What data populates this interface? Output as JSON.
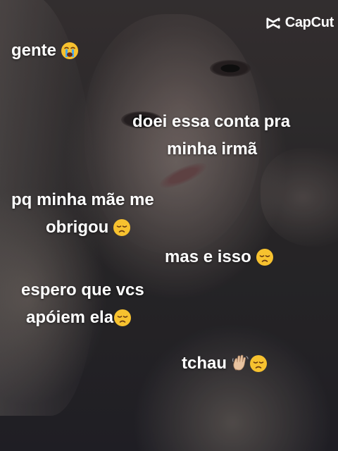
{
  "watermark": {
    "label": "CapCut",
    "icon": "capcut-logo-icon"
  },
  "captions": [
    {
      "text": "gente",
      "emoji": "loudly-crying-face-icon"
    },
    {
      "text": "doei essa conta pra"
    },
    {
      "text": "minha irmã"
    },
    {
      "text": "pq minha mãe me"
    },
    {
      "text": "obrigou",
      "emoji": "disappointed-face-icon"
    },
    {
      "text": "mas e isso",
      "emoji": "disappointed-face-icon"
    },
    {
      "text": "espero que vcs"
    },
    {
      "text": "apóiem ela",
      "emoji": "disappointed-face-icon"
    },
    {
      "text": "tchau",
      "emoji": [
        "waving-hand-icon",
        "disappointed-face-icon"
      ]
    }
  ],
  "colors": {
    "caption_text": "#ffffff",
    "emoji_face": "#f7c22f"
  }
}
